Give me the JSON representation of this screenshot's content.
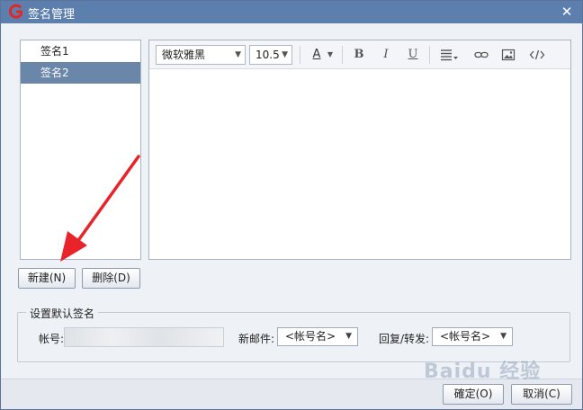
{
  "window": {
    "title": "签名管理",
    "close_symbol": "✕"
  },
  "signatures": {
    "items": [
      {
        "label": "签名1",
        "selected": false
      },
      {
        "label": "签名2",
        "selected": true
      }
    ]
  },
  "editor_toolbar": {
    "font_family": "微软雅黑",
    "font_size": "10.5",
    "font_color_label": "A",
    "bold_label": "B",
    "italic_label": "I",
    "underline_label": "U"
  },
  "actions": {
    "new_label": "新建(N)",
    "delete_label": "删除(D)"
  },
  "default_signature": {
    "legend": "设置默认签名",
    "account_label": "帐号:",
    "new_mail_label": "新邮件:",
    "new_mail_value": "<帐号名>",
    "reply_forward_label": "回复/转发:",
    "reply_forward_value": "<帐号名>"
  },
  "footer": {
    "ok_label": "確定(O)",
    "cancel_label": "取消(C)"
  },
  "watermark": "Baidu 经验",
  "colors": {
    "titlebar": "#5d7fae",
    "selected_item": "#6a86a9",
    "arrow": "#e8232a",
    "logo": "#e02828"
  }
}
